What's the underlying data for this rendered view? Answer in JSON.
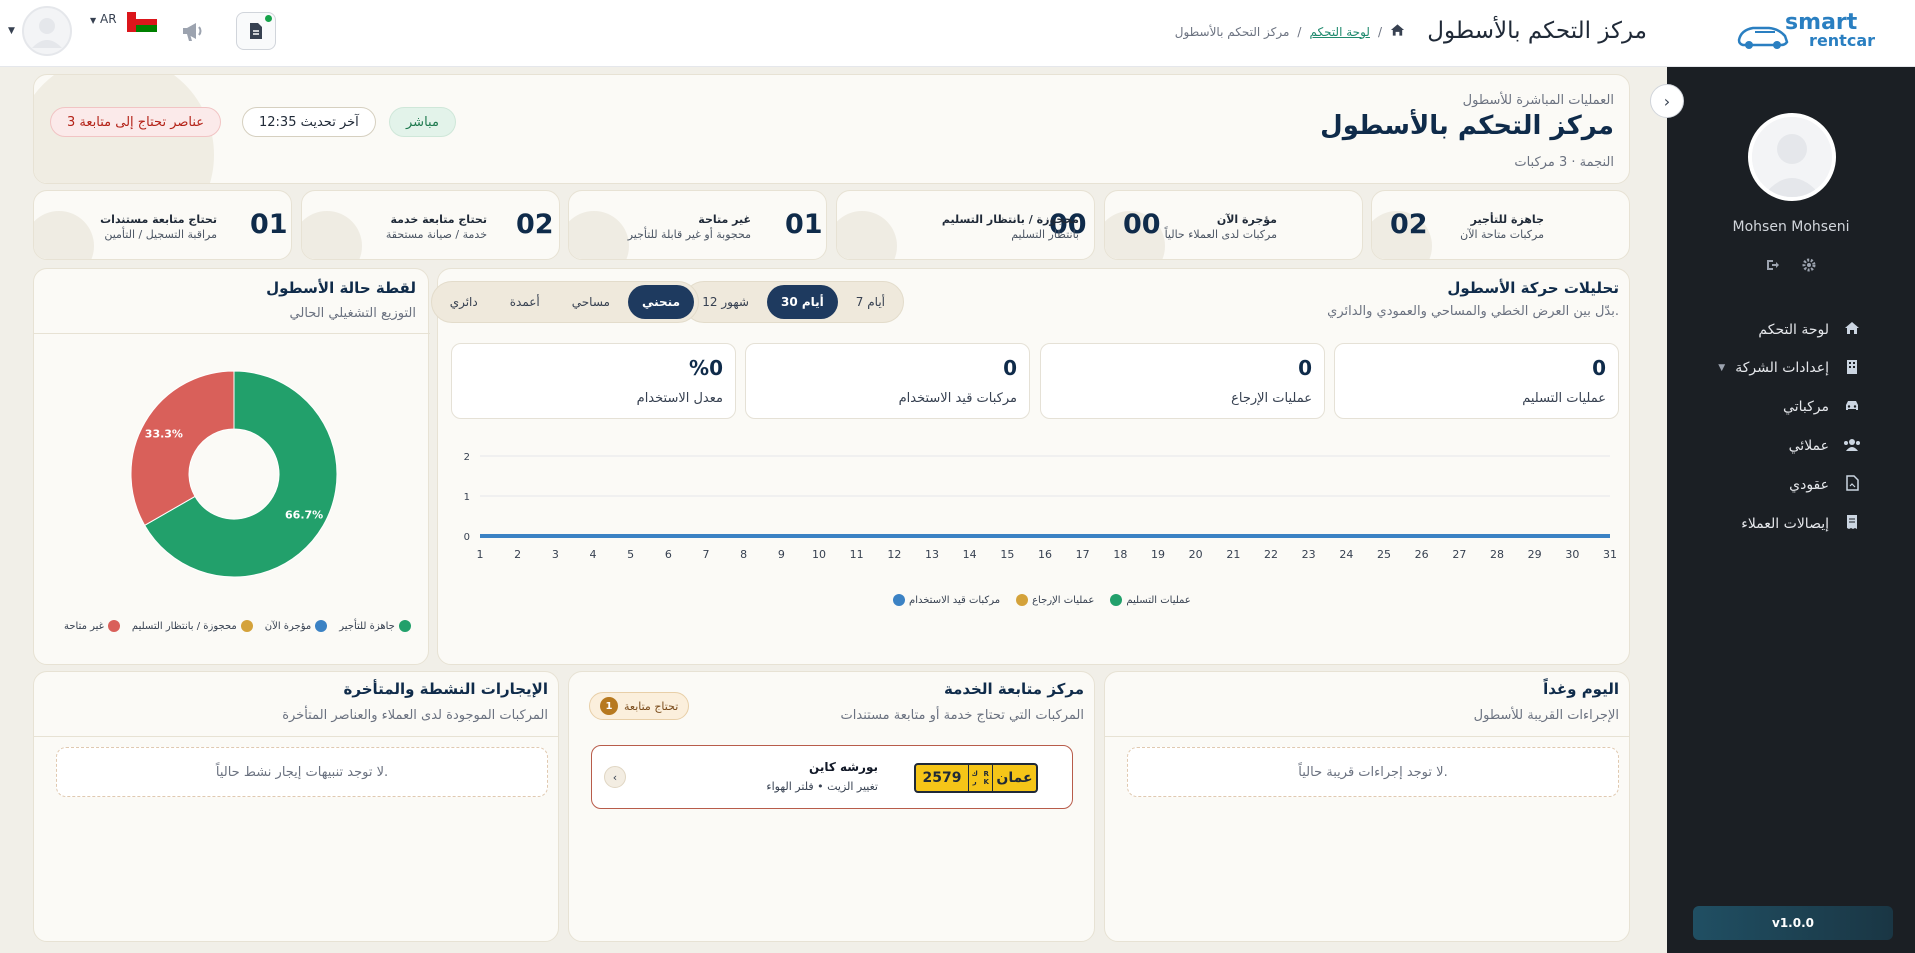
{
  "header": {
    "title": "مركز التحكم بالأسطول",
    "breadcrumb": {
      "dashboard": "لوحة التحكم",
      "separator": "/",
      "current": "مركز التحكم بالأسطول"
    },
    "logo": {
      "line1": "smart",
      "line2": "rentcar"
    },
    "language": "AR",
    "doc_icon": "document-icon",
    "announce_icon": "megaphone-icon"
  },
  "sidebar": {
    "user_name": "Mohsen Mohseni",
    "items": [
      {
        "label": "لوحة التحكم",
        "icon": "home-icon"
      },
      {
        "label": "إعدادات الشركة",
        "icon": "building-icon"
      },
      {
        "label": "مركباتي",
        "icon": "car-icon"
      },
      {
        "label": "عملائي",
        "icon": "users-icon"
      },
      {
        "label": "عقودي",
        "icon": "contract-icon"
      },
      {
        "label": "إيصالات العملاء",
        "icon": "receipt-icon"
      }
    ],
    "version": "v1.0.0"
  },
  "hero": {
    "eyebrow": "العمليات المباشرة للأسطول",
    "title": "مركز التحكم بالأسطول",
    "subtitle": "النجمة · 3 مركبات",
    "live": "مباشر",
    "updated": "آخر تحديث 12:35",
    "attention": "3 عناصر تحتاج إلى متابعة"
  },
  "stats": [
    {
      "value": "02",
      "label": "جاهزة للتأجير",
      "sub": "مركبات متاحة الآن"
    },
    {
      "value": "00",
      "label": "مؤجرة الآن",
      "sub": "مركبات لدى العملاء حالياً"
    },
    {
      "value": "00",
      "label": "محجوزة / بانتظار التسليم",
      "sub": "بانتظار التسليم"
    },
    {
      "value": "01",
      "label": "غير متاحة",
      "sub": "محجوبة أو غير قابلة للتأجير"
    },
    {
      "value": "02",
      "label": "تحتاج متابعة خدمة",
      "sub": "خدمة / صيانة مستحقة"
    },
    {
      "value": "01",
      "label": "تحتاج متابعة مستندات",
      "sub": "مراقبة التسجيل / التأمين"
    }
  ],
  "analytics": {
    "title": "تحليلات حركة الأسطول",
    "subtitle": "بدّل بين العرض الخطي والمساحي والعمودي والدائري.",
    "ranges": [
      "7 أيام",
      "30 أيام",
      "12 شهور"
    ],
    "active_range": "30 أيام",
    "types": [
      "منحني",
      "مساحي",
      "أعمدة",
      "دائري"
    ],
    "active_type": "منحني",
    "kpis": [
      {
        "value": "0",
        "label": "عمليات التسليم"
      },
      {
        "value": "0",
        "label": "عمليات الإرجاع"
      },
      {
        "value": "0",
        "label": "مركبات قيد الاستخدام"
      },
      {
        "value": "%0",
        "label": "معدل الاستخدام"
      }
    ]
  },
  "chart_data": [
    {
      "type": "line",
      "x": [
        1,
        2,
        3,
        4,
        5,
        6,
        7,
        8,
        9,
        10,
        11,
        12,
        13,
        14,
        15,
        16,
        17,
        18,
        19,
        20,
        21,
        22,
        23,
        24,
        25,
        26,
        27,
        28,
        29,
        30,
        31
      ],
      "ylim": [
        0,
        2
      ],
      "yticks": [
        0,
        1,
        2
      ],
      "grid": true,
      "legend_placement": "bottom",
      "series": [
        {
          "name": "عمليات التسليم",
          "color": "#22a06b",
          "values": [
            0,
            0,
            0,
            0,
            0,
            0,
            0,
            0,
            0,
            0,
            0,
            0,
            0,
            0,
            0,
            0,
            0,
            0,
            0,
            0,
            0,
            0,
            0,
            0,
            0,
            0,
            0,
            0,
            0,
            0,
            0
          ]
        },
        {
          "name": "عمليات الإرجاع",
          "color": "#d4a23a",
          "values": [
            0,
            0,
            0,
            0,
            0,
            0,
            0,
            0,
            0,
            0,
            0,
            0,
            0,
            0,
            0,
            0,
            0,
            0,
            0,
            0,
            0,
            0,
            0,
            0,
            0,
            0,
            0,
            0,
            0,
            0,
            0
          ]
        },
        {
          "name": "مركبات قيد الاستخدام",
          "color": "#3b82c4",
          "values": [
            0,
            0,
            0,
            0,
            0,
            0,
            0,
            0,
            0,
            0,
            0,
            0,
            0,
            0,
            0,
            0,
            0,
            0,
            0,
            0,
            0,
            0,
            0,
            0,
            0,
            0,
            0,
            0,
            0,
            0,
            0
          ]
        }
      ]
    },
    {
      "type": "pie",
      "title": "لقطة حالة الأسطول",
      "subtitle": "التوزيع التشغيلي الحالي",
      "legend_placement": "bottom",
      "slices": [
        {
          "name": "جاهزة للتأجير",
          "value": 66.7,
          "label": "66.7%",
          "color": "#22a06b"
        },
        {
          "name": "مؤجرة الآن",
          "value": 0,
          "color": "#3b82c4"
        },
        {
          "name": "محجوزة / بانتظار التسليم",
          "value": 0,
          "color": "#d4a23a"
        },
        {
          "name": "غير متاحة",
          "value": 33.3,
          "label": "33.3%",
          "color": "#d9605a"
        }
      ]
    }
  ],
  "today": {
    "title": "اليوم وغداً",
    "subtitle": "الإجراءات القريبة للأسطول",
    "empty": "لا توجد إجراءات قريبة حالياً."
  },
  "service": {
    "title": "مركز متابعة الخدمة",
    "subtitle": "المركبات التي تحتاج خدمة أو متابعة مستندات",
    "badge": "تحتاج متابعة",
    "badge_count": "1",
    "item": {
      "plate_country": "عمان",
      "plate_code": "ك ر",
      "plate_code_latin": "R K",
      "plate_number": "2579",
      "name": "بورشه كاين",
      "desc": "تغيير الزيت • فلتر الهواء"
    }
  },
  "rentals": {
    "title": "الإيجارات النشطة والمتأخرة",
    "subtitle": "المركبات الموجودة لدى العملاء والعناصر المتأخرة",
    "empty": "لا توجد تنبيهات إيجار نشط حالياً."
  }
}
